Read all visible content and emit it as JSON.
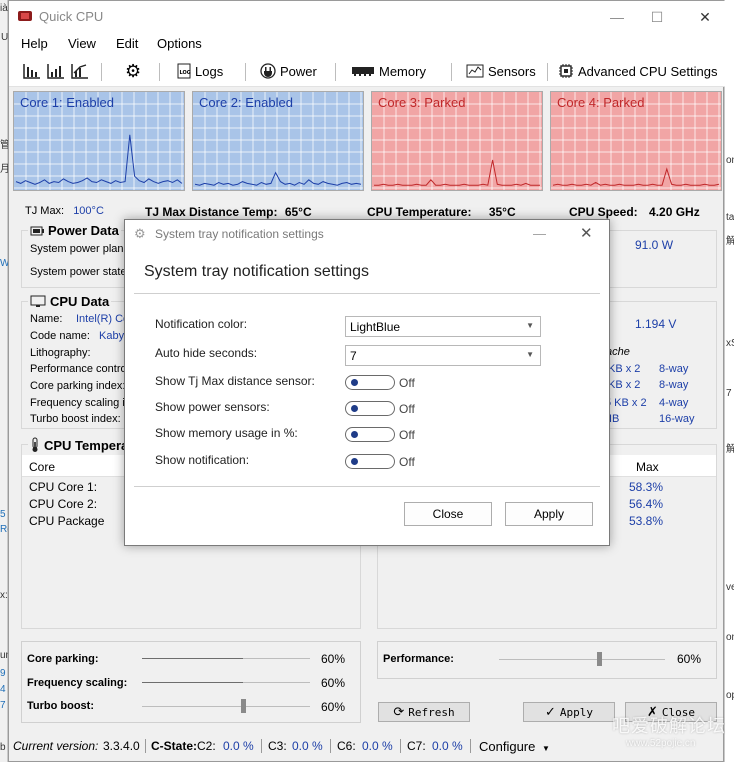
{
  "window": {
    "title": "Quick CPU"
  },
  "menu": [
    "Help",
    "View",
    "Edit",
    "Options"
  ],
  "toolbar": {
    "logs": "Logs",
    "power": "Power",
    "memory": "Memory",
    "sensors": "Sensors",
    "advanced": "Advanced CPU Settings"
  },
  "cores": [
    {
      "label": "Core 1: Enabled",
      "state": "enabled"
    },
    {
      "label": "Core 2: Enabled",
      "state": "enabled"
    },
    {
      "label": "Core 3: Parked",
      "state": "parked"
    },
    {
      "label": "Core 4: Parked",
      "state": "parked"
    }
  ],
  "colors": {
    "enabled_bg": "#a9c4e8",
    "enabled_line": "#1d3fa8",
    "enabled_text": "#1d3fa8",
    "parked_bg": "#f1a5a5",
    "parked_line": "#c0282a",
    "parked_text": "#c0282a"
  },
  "info": {
    "tjmax_label": "TJ Max:",
    "tjmax_value": "100°C",
    "tjdist_label": "TJ Max Distance Temp:",
    "tjdist_value": "65°C",
    "cputemp_label": "CPU Temperature:",
    "cputemp_value": "35°C",
    "cpuspeed_label": "CPU Speed:",
    "cpuspeed_value": "4.20 GHz"
  },
  "power_data": {
    "title": "Power Data",
    "plan_label": "System power plan:",
    "state_label": "System power state:",
    "right_value": "91.0 W"
  },
  "cpu_data": {
    "title": "CPU Data",
    "name_label": "Name:",
    "name_value": "Intel(R) Co",
    "codename_label": "Code name:",
    "codename_value": "Kaby",
    "lithography_label": "Lithography:",
    "perf_label": "Performance control",
    "parking_label": "Core parking index:",
    "freq_label": "Frequency scaling in",
    "turbo_label": "Turbo boost index:",
    "voltage_value": "1.194 V",
    "cache_label": "ache",
    "cache_rows": [
      {
        "size": "KB x 2",
        "way": "8-way"
      },
      {
        "size": "KB x 2",
        "way": "8-way"
      },
      {
        "size": "5 KB x 2",
        "way": "4-way"
      },
      {
        "size": "IB",
        "way": "16-way"
      }
    ]
  },
  "cpu_temp": {
    "title": "CPU Tempera",
    "col_core": "Core",
    "col_max": "Max",
    "rows": [
      {
        "label": "CPU Core 1:",
        "max": "58.3%"
      },
      {
        "label": "CPU Core 2:",
        "max": "56.4%"
      },
      {
        "label": "CPU Package",
        "max": "53.8%"
      }
    ]
  },
  "sliders": {
    "parking": {
      "label": "Core parking:",
      "value": "60%",
      "fraction": 0.6
    },
    "frequency": {
      "label": "Frequency scaling:",
      "value": "60%",
      "fraction": 0.6
    },
    "turbo": {
      "label": "Turbo boost:",
      "value": "60%",
      "fraction": 0.6
    },
    "performance": {
      "label": "Performance:",
      "value": "60%",
      "fraction": 0.6
    }
  },
  "buttons": {
    "refresh": "Refresh",
    "apply": "Apply",
    "close": "Close"
  },
  "status": {
    "version_label": "Current version:",
    "version_value": "3.3.4.0",
    "cstate_label": "C-State:",
    "c2_label": "C2:",
    "c2_value": "0.0 %",
    "c3_label": "C3:",
    "c3_value": "0.0 %",
    "c6_label": "C6:",
    "c6_value": "0.0 %",
    "c7_label": "C7:",
    "c7_value": "0.0 %",
    "configure": "Configure"
  },
  "dialog": {
    "title": "System tray notification settings",
    "heading": "System tray notification settings",
    "rows": {
      "color": {
        "label": "Notification color:",
        "value": "LightBlue"
      },
      "autohide": {
        "label": "Auto hide seconds:",
        "value": "7"
      },
      "tjmax": {
        "label": "Show Tj Max distance sensor:",
        "value": "Off"
      },
      "power": {
        "label": "Show power sensors:",
        "value": "Off"
      },
      "memory": {
        "label": "Show memory usage in %:",
        "value": "Off"
      },
      "notification": {
        "label": "Show notification:",
        "value": "Off"
      }
    },
    "close": "Close",
    "apply": "Apply"
  },
  "background": {
    "left": [
      "ià",
      "U",
      "",
      "管",
      "月",
      "",
      "W",
      "",
      "",
      "",
      "",
      "",
      "",
      "",
      "5",
      "Rc",
      "",
      "",
      "x:",
      "",
      "",
      "um",
      "9",
      "4",
      "7",
      "b"
    ],
    "right": [
      "on",
      "ta",
      "解",
      "xS",
      "7",
      "解",
      "ve",
      "on",
      "op",
      "解",
      "rs"
    ],
    "watermark": "吧爱破解论坛",
    "watermark_url": "www.52pojie.cn"
  }
}
